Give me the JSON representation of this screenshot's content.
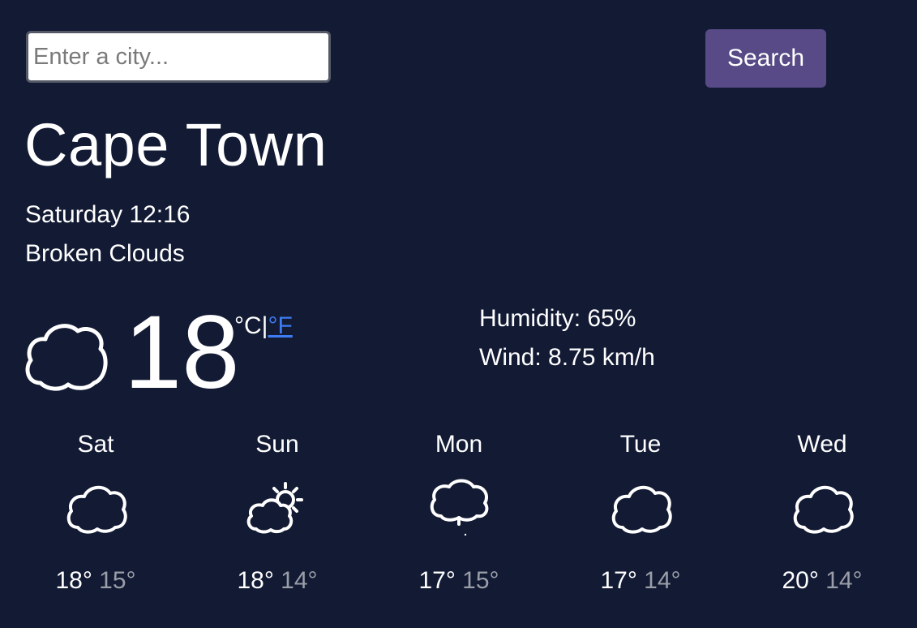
{
  "search": {
    "placeholder": "Enter a city...",
    "button_label": "Search"
  },
  "current": {
    "city": "Cape Town",
    "date_time": "Saturday 12:16",
    "description": "Broken Clouds",
    "temperature": "18",
    "unit_celsius": "°C",
    "unit_separator": "|",
    "unit_fahrenheit": "°F",
    "humidity": "Humidity: 65%",
    "wind": "Wind: 8.75 km/h",
    "icon": "cloud-icon"
  },
  "forecast": [
    {
      "day": "Sat",
      "icon": "cloud-icon",
      "max": "18°",
      "min": "15°"
    },
    {
      "day": "Sun",
      "icon": "sun-behind-cloud-icon",
      "max": "18°",
      "min": "14°"
    },
    {
      "day": "Mon",
      "icon": "cloud-rain-icon",
      "max": "17°",
      "min": "15°"
    },
    {
      "day": "Tue",
      "icon": "cloud-icon",
      "max": "17°",
      "min": "14°"
    },
    {
      "day": "Wed",
      "icon": "cloud-icon",
      "max": "20°",
      "min": "14°"
    }
  ],
  "colors": {
    "background": "#121a34",
    "button": "#574a86",
    "link": "#3d7cf2",
    "min_temp": "#9a9ea8"
  }
}
